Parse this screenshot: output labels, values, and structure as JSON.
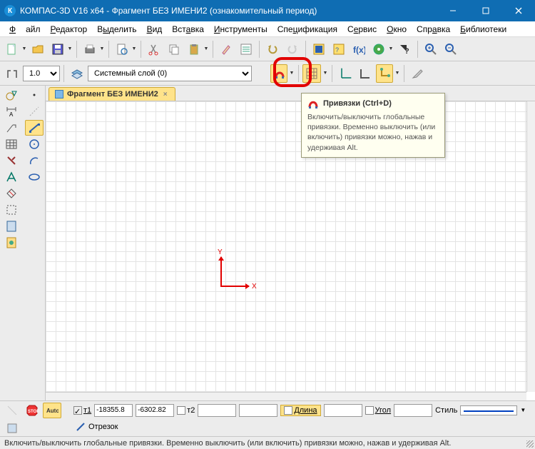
{
  "titlebar": {
    "title": "КОМПАС-3D V16  x64 - Фрагмент БЕЗ ИМЕНИ2 (ознакомительный период)"
  },
  "menubar": {
    "file": "Файл",
    "editor": "Редактор",
    "select": "Выделить",
    "view": "Вид",
    "insert": "Вставка",
    "tools": "Инструменты",
    "spec": "Спецификация",
    "service": "Сервис",
    "window": "Окно",
    "help": "Справка",
    "libs": "Библиотеки"
  },
  "toolbar": {
    "scale": "1.0",
    "layer": "Системный слой (0)"
  },
  "doctab": {
    "label": "Фрагмент БЕЗ ИМЕНИ2",
    "close": "×"
  },
  "tooltip": {
    "title": "Привязки (Ctrl+D)",
    "body": "Включить/выключить глобальные привязки. Временно выключить (или включить) привязки можно, нажав и удерживая Alt."
  },
  "origin": {
    "x": "X",
    "y": "Y"
  },
  "bottom": {
    "t1": "т1",
    "t1x": "-18355.8",
    "t1y": "-6302.82",
    "t2": "т2",
    "t2x": "",
    "t2y": "",
    "len_lbl": "Длина",
    "len_val": "",
    "ang_lbl": "Угол",
    "ang_val": "",
    "style_lbl": "Стиль",
    "tool_name": "Отрезок"
  },
  "statusbar": {
    "text": "Включить/выключить глобальные привязки. Временно выключить (или включить) привязки можно, нажав и удерживая Alt."
  }
}
